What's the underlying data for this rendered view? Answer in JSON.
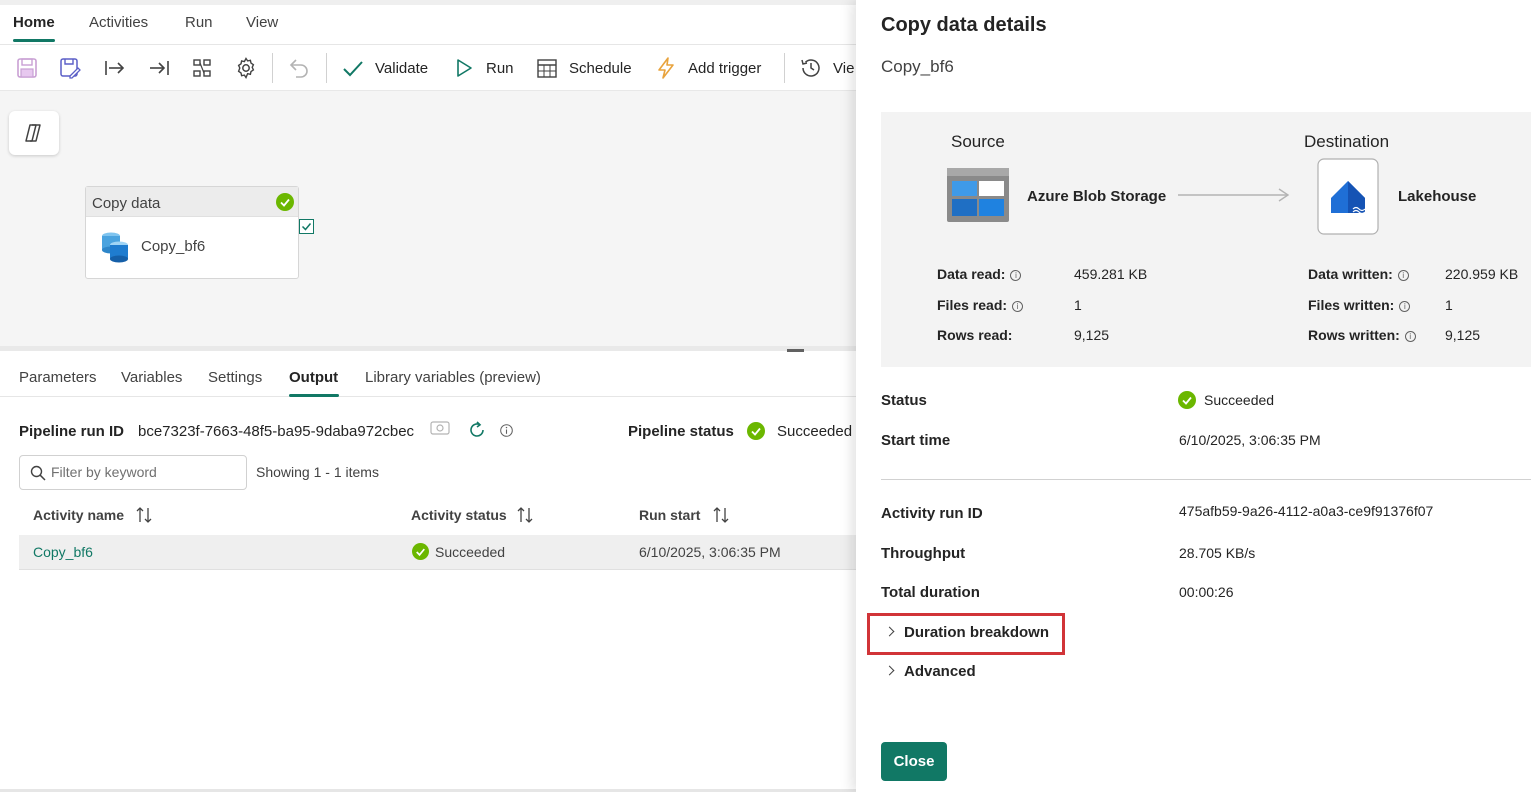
{
  "menu": {
    "tabs": [
      {
        "label": "Home"
      },
      {
        "label": "Activities"
      },
      {
        "label": "Run"
      },
      {
        "label": "View"
      }
    ]
  },
  "toolbar": {
    "validate_label": "Validate",
    "run_label": "Run",
    "schedule_label": "Schedule",
    "add_trigger_label": "Add trigger",
    "view_label": "Vie"
  },
  "canvas": {
    "activity_title": "Copy data",
    "activity_name": "Copy_bf6"
  },
  "output_panel": {
    "tabs": [
      {
        "label": "Parameters"
      },
      {
        "label": "Variables"
      },
      {
        "label": "Settings"
      },
      {
        "label": "Output"
      },
      {
        "label": "Library variables (preview)"
      }
    ],
    "run_id_label": "Pipeline run ID",
    "run_id_value": "bce7323f-7663-48f5-ba95-9daba972cbec",
    "pipeline_status_label": "Pipeline status",
    "pipeline_status_value": "Succeeded",
    "filter_placeholder": "Filter by keyword",
    "showing_text": "Showing 1 - 1 items",
    "columns": {
      "activity_name": "Activity name",
      "activity_status": "Activity status",
      "run_start": "Run start"
    },
    "rows": [
      {
        "activity_name": "Copy_bf6",
        "activity_status": "Succeeded",
        "run_start": "6/10/2025, 3:06:35 PM"
      }
    ]
  },
  "details": {
    "title": "Copy data details",
    "subtitle": "Copy_bf6",
    "source_heading": "Source",
    "source_name": "Azure Blob Storage",
    "destination_heading": "Destination",
    "destination_name": "Lakehouse",
    "source_stats": {
      "data_read_label": "Data read:",
      "data_read_value": "459.281 KB",
      "files_read_label": "Files read:",
      "files_read_value": "1",
      "rows_read_label": "Rows read:",
      "rows_read_value": "9,125"
    },
    "dest_stats": {
      "data_written_label": "Data written:",
      "data_written_value": "220.959 KB",
      "files_written_label": "Files written:",
      "files_written_value": "1",
      "rows_written_label": "Rows written:",
      "rows_written_value": "9,125"
    },
    "status_label": "Status",
    "status_value": "Succeeded",
    "start_time_label": "Start time",
    "start_time_value": "6/10/2025, 3:06:35 PM",
    "activity_run_id_label": "Activity run ID",
    "activity_run_id_value": "475afb59-9a26-4112-a0a3-ce9f91376f07",
    "throughput_label": "Throughput",
    "throughput_value": "28.705 KB/s",
    "total_duration_label": "Total duration",
    "total_duration_value": "00:00:26",
    "duration_breakdown_label": "Duration breakdown",
    "advanced_label": "Advanced",
    "close_label": "Close"
  },
  "colors": {
    "accent": "#117865",
    "success": "#6bb700",
    "highlight": "#d13438"
  }
}
